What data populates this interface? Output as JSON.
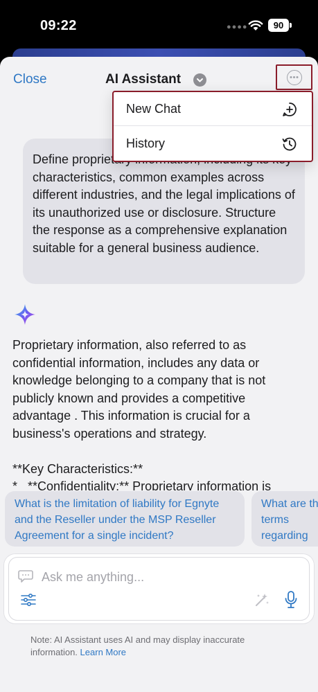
{
  "status_bar": {
    "time": "09:22",
    "battery": "90"
  },
  "header": {
    "close_label": "Close",
    "title": "AI Assistant"
  },
  "menu": {
    "items": [
      {
        "label": "New Chat",
        "icon": "new-chat-icon"
      },
      {
        "label": "History",
        "icon": "history-icon"
      }
    ]
  },
  "conversation": {
    "user_prompt": "Define proprietary information, including its key characteristics, common examples across different industries, and the legal implications of its unauthorized use or disclosure. Structure the response as a comprehensive explanation suitable for a general business audience.",
    "assistant_response": "Proprietary information, also referred to as confidential information, includes any data or knowledge belonging to a company that is not publicly known and provides a competitive advantage . This information is crucial for a business's operations and strategy.\n\n**Key Characteristics:**\n*   **Confidentiality:** Proprietary information is"
  },
  "suggestions": [
    "What is the limitation of liability for Egnyte and the Reseller under the MSP Reseller Agreement for a single incident?",
    "What are the terms regarding the Egnyte's Services"
  ],
  "input": {
    "placeholder": "Ask me anything..."
  },
  "footer": {
    "note": "Note: AI Assistant uses AI and may display inaccurate information.",
    "learn_more": "Learn More"
  },
  "colors": {
    "accent": "#2f78c4",
    "highlight_border": "#8a1c2a",
    "sheet_background": "#f2f2f4",
    "bubble_background": "#e2e2e8"
  }
}
